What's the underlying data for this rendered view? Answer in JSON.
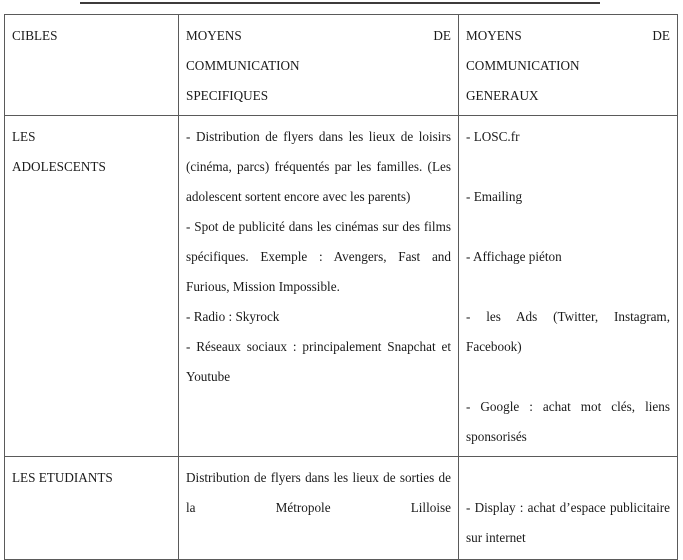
{
  "document": {
    "top_rule": "horizontal-rule-fragment"
  },
  "table": {
    "headers": {
      "col1": "CIBLES",
      "col2_line1": "MOYENS",
      "col2_de": "DE",
      "col2_line2": "COMMUNICATION",
      "col2_line3": "SPECIFIQUES",
      "col3_line1": "MOYENS",
      "col3_de": "DE",
      "col3_line2": "COMMUNICATION",
      "col3_line3": "GENERAUX"
    },
    "rows": [
      {
        "cible_line1": "LES",
        "cible_line2": "ADOLESCENTS",
        "specifiques": [
          "- Distribution de flyers dans les lieux de loisirs (cinéma, parcs) fréquentés par les familles. (Les adolescent sortent encore avec les parents)",
          "- Spot de publicité dans les cinémas sur des films spécifiques. Exemple : Avengers, Fast and Furious, Mission Impossible.",
          "- Radio : Skyrock",
          "- Réseaux sociaux : principalement Snapchat et Youtube"
        ],
        "generaux": [
          "- LOSC.fr",
          "",
          "- Emailing",
          "",
          "- Affichage piéton",
          "",
          "- les Ads (Twitter, Instagram, Facebook)",
          "",
          "- Google : achat mot clés, liens sponsorisés"
        ]
      },
      {
        "cible_line1": "LES ETUDIANTS",
        "cible_line2": "",
        "specifiques": [
          "Distribution de flyers dans les lieux de sorties de la Métropole Lilloise"
        ],
        "generaux": [
          "",
          "- Display : achat d’espace publicitaire sur internet"
        ]
      }
    ]
  }
}
